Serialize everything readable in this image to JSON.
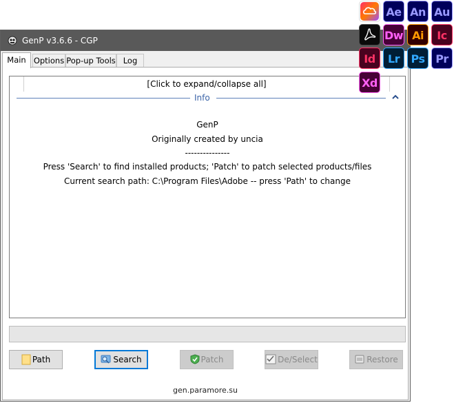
{
  "window": {
    "title": "GenP v3.6.6 - CGP"
  },
  "tabs": [
    {
      "label": "Main",
      "active": true
    },
    {
      "label": "Options",
      "active": false
    },
    {
      "label": "Pop-up Tools",
      "active": false
    },
    {
      "label": "Log",
      "active": false
    }
  ],
  "main": {
    "expand_label": "[Click to expand/collapse all]",
    "group_title": "Info",
    "info_lines": [
      "GenP",
      "Originally created by uncia",
      "---------------",
      "Press 'Search' to find installed products; 'Patch' to patch selected products/files",
      "Current search path: C:\\Program Files\\Adobe -- press 'Path' to change"
    ],
    "progress": 0
  },
  "buttons": {
    "path": "Path",
    "search": "Search",
    "patch": "Patch",
    "deselect": "De/Select",
    "restore": "Restore"
  },
  "footer": "gen.paramore.su",
  "adobe_apps": [
    {
      "abbr": "",
      "icon": "creative-cloud-icon",
      "bg": "#ffffff"
    },
    {
      "abbr": "Ae",
      "bg": "#00005b",
      "fg": "#9999ff"
    },
    {
      "abbr": "An",
      "bg": "#00005b",
      "fg": "#9999ff"
    },
    {
      "abbr": "Au",
      "bg": "#00005b",
      "fg": "#9999ff"
    },
    {
      "abbr": "",
      "icon": "acrobat-icon",
      "bg": "#0a0a0a"
    },
    {
      "abbr": "Dw",
      "bg": "#470137",
      "fg": "#ff61f6"
    },
    {
      "abbr": "Ai",
      "bg": "#330000",
      "fg": "#ff9a00"
    },
    {
      "abbr": "Ic",
      "bg": "#49021f",
      "fg": "#ff3366"
    },
    {
      "abbr": "Id",
      "bg": "#49021f",
      "fg": "#ff3366"
    },
    {
      "abbr": "Lr",
      "bg": "#001e36",
      "fg": "#31a8ff"
    },
    {
      "abbr": "Ps",
      "bg": "#001e36",
      "fg": "#31a8ff"
    },
    {
      "abbr": "Pr",
      "bg": "#00005b",
      "fg": "#9999ff"
    },
    {
      "abbr": "Xd",
      "bg": "#470137",
      "fg": "#ff61f6"
    }
  ]
}
